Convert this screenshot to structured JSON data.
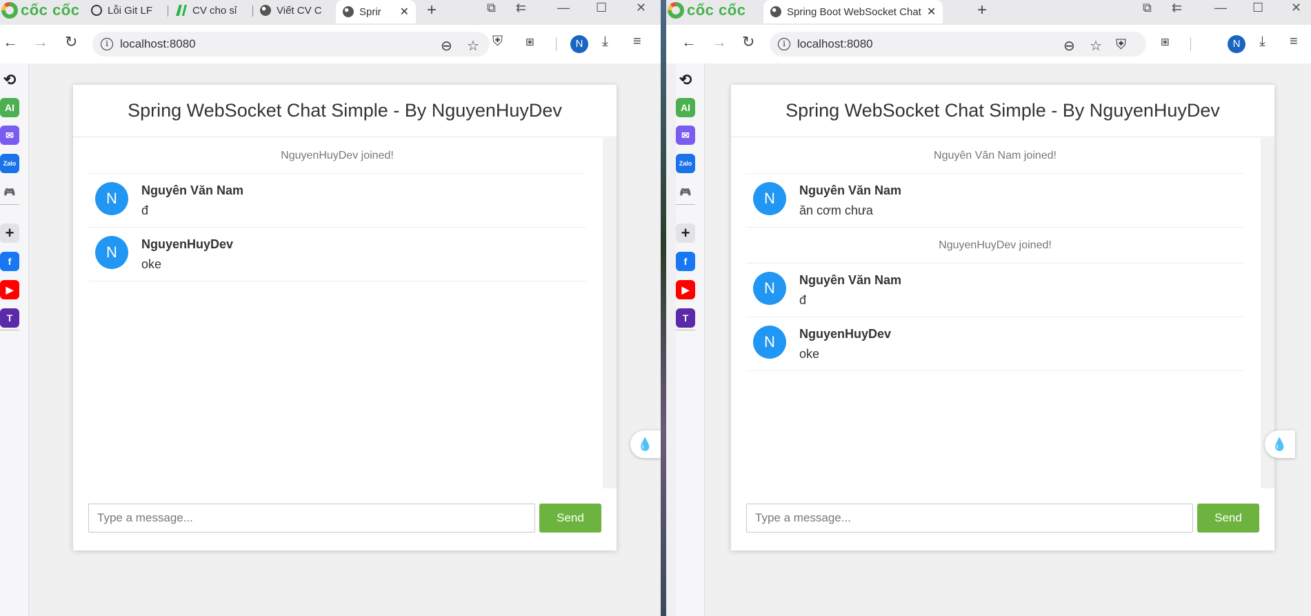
{
  "colors": {
    "accent": "#6db33f",
    "avatar": "#2196f3",
    "brand": "#48b24b",
    "profile": "#1966c2"
  },
  "windows": [
    {
      "brand": "cốc cốc",
      "tabs": [
        {
          "label": "Lỗi Git LF",
          "icon": "chatgpt-icon"
        },
        {
          "label": "CV cho sỉ",
          "icon": "topcv-icon"
        },
        {
          "label": "Viết CV C",
          "icon": "globe-icon"
        },
        {
          "label": "Sprir",
          "icon": "globe-icon",
          "active": true
        }
      ],
      "url": "localhost:8080",
      "profile_initial": "N",
      "chat": {
        "title": "Spring WebSocket Chat Simple - By NguyenHuyDev",
        "items": [
          {
            "type": "event",
            "text": "NguyenHuyDev joined!"
          },
          {
            "type": "message",
            "avatar": "N",
            "name": "Nguyên Văn Nam",
            "text": "đ"
          },
          {
            "type": "message",
            "avatar": "N",
            "name": "NguyenHuyDev",
            "text": "oke"
          }
        ],
        "input_placeholder": "Type a message...",
        "send_label": "Send"
      }
    },
    {
      "brand": "cốc cốc",
      "tabs": [
        {
          "label": "Spring Boot WebSocket Chat",
          "icon": "globe-icon",
          "active": true
        }
      ],
      "url": "localhost:8080",
      "profile_initial": "N",
      "chat": {
        "title": "Spring WebSocket Chat Simple - By NguyenHuyDev",
        "items": [
          {
            "type": "event",
            "text": "Nguyên Văn Nam joined!"
          },
          {
            "type": "message",
            "avatar": "N",
            "name": "Nguyên Văn Nam",
            "text": "ăn cơm chưa"
          },
          {
            "type": "event",
            "text": "NguyenHuyDev joined!"
          },
          {
            "type": "message",
            "avatar": "N",
            "name": "Nguyên Văn Nam",
            "text": "đ"
          },
          {
            "type": "message",
            "avatar": "N",
            "name": "NguyenHuyDev",
            "text": "oke"
          }
        ],
        "input_placeholder": "Type a message...",
        "send_label": "Send"
      }
    }
  ],
  "sidebar": [
    {
      "name": "history-icon",
      "glyph": "⟲",
      "bg": "transparent",
      "color": "#222"
    },
    {
      "name": "ai-assistant-icon",
      "glyph": "AI",
      "bg": "#4caf50",
      "color": "#fff"
    },
    {
      "name": "messenger-icon",
      "glyph": "✉",
      "bg": "#7b5cf0",
      "color": "#fff"
    },
    {
      "name": "zalo-icon",
      "glyph": "Zalo",
      "bg": "#1a73e8",
      "color": "#fff"
    },
    {
      "name": "game-icon",
      "glyph": "🎮",
      "bg": "transparent",
      "color": "#3a9a4a"
    },
    {
      "name": "add-icon",
      "glyph": "+",
      "bg": "#e3e3e6",
      "color": "#222"
    },
    {
      "name": "facebook-icon",
      "glyph": "f",
      "bg": "#1877f2",
      "color": "#fff"
    },
    {
      "name": "youtube-icon",
      "glyph": "▶",
      "bg": "#ff0000",
      "color": "#fff"
    },
    {
      "name": "t-app-icon",
      "glyph": "T",
      "bg": "#5b2aa8",
      "color": "#fff"
    }
  ]
}
